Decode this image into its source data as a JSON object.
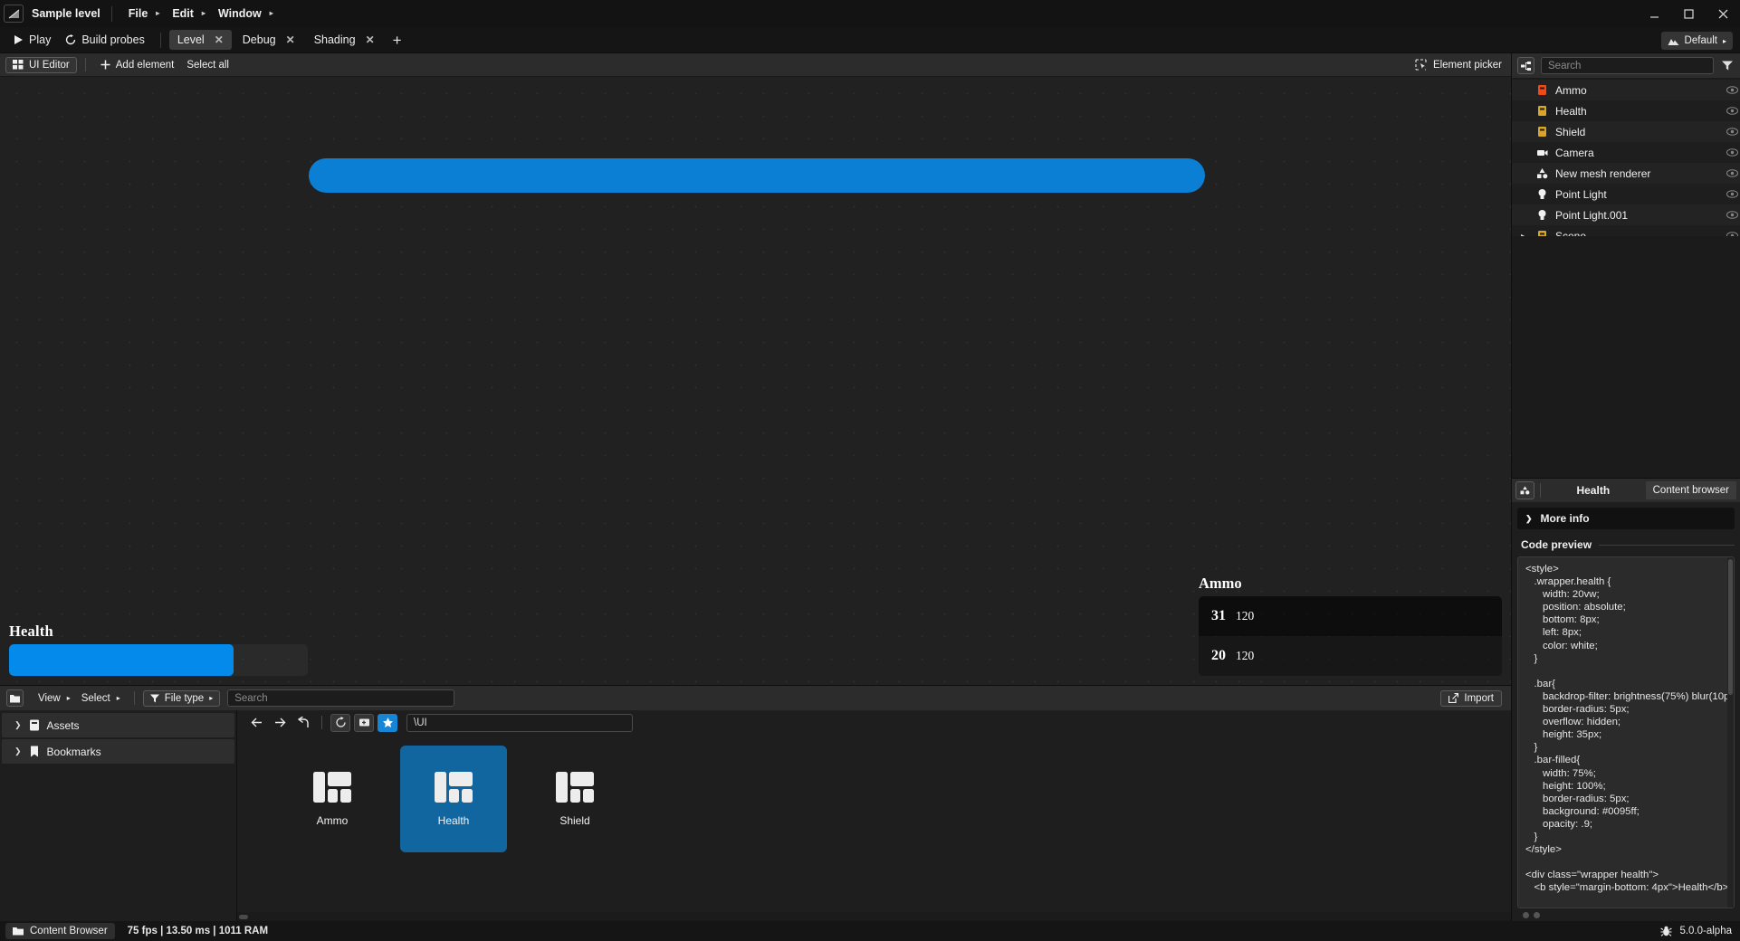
{
  "titlebar": {
    "logo_icon": "app-logo-icon",
    "project_title": "Sample level",
    "menus": [
      {
        "label": "File",
        "caret": "▸"
      },
      {
        "label": "Edit",
        "caret": "▸"
      },
      {
        "label": "Window",
        "caret": "▸"
      }
    ],
    "window_controls": [
      "minimize-icon",
      "maximize-icon",
      "close-icon"
    ]
  },
  "tabstrip": {
    "play_label": "Play",
    "build_probes_label": "Build probes",
    "tabs": [
      {
        "label": "Level",
        "active": true,
        "close": "✕"
      },
      {
        "label": "Debug",
        "active": false,
        "close": "✕"
      },
      {
        "label": "Shading",
        "active": false,
        "close": "✕"
      }
    ],
    "add_tab": "+",
    "layout": {
      "icon": "mountain-icon",
      "label": "Default",
      "caret": "▸"
    }
  },
  "editor_toolbar": {
    "mode_chip": "UI Editor",
    "add_element_label": "Add element",
    "select_all_label": "Select all",
    "element_picker_label": "Element picker"
  },
  "viewport": {
    "top_bar_color": "#0b7fd4",
    "health_widget": {
      "title": "Health",
      "fill_percent": 75,
      "fill_color": "#0095ff"
    },
    "ammo_widget": {
      "title": "Ammo",
      "rows": [
        {
          "current": "31",
          "max": "120"
        },
        {
          "current": "20",
          "max": "120"
        }
      ]
    }
  },
  "content_browser": {
    "folder_icon": "folder-icon",
    "view_label": "View",
    "select_label": "Select",
    "file_type_label": "File type",
    "search_placeholder": "Search",
    "search_value": "",
    "import_label": "Import",
    "tree": [
      {
        "label": "Assets",
        "icon": "assets-icon",
        "caret": "❯"
      },
      {
        "label": "Bookmarks",
        "icon": "bookmark-icon",
        "caret": "❯"
      }
    ],
    "nav": {
      "back": "arrow-left-icon",
      "forward": "arrow-right-icon",
      "up": "arrow-up-level-icon",
      "refresh": "refresh-icon",
      "new_folder": "new-item-icon",
      "favorite": "star-icon",
      "path_value": "\\UI"
    },
    "tiles": [
      {
        "label": "Ammo",
        "icon": "ui-layout-icon",
        "selected": false
      },
      {
        "label": "Health",
        "icon": "ui-layout-icon",
        "selected": true
      },
      {
        "label": "Shield",
        "icon": "ui-layout-icon",
        "selected": false
      }
    ]
  },
  "hierarchy": {
    "tree_icon": "hierarchy-icon",
    "search_placeholder": "Search",
    "search_value": "",
    "filter_icon": "funnel-icon",
    "nodes": [
      {
        "label": "Ammo",
        "icon": "ui-widget-icon",
        "icon_color": "#f04a16",
        "expandable": false
      },
      {
        "label": "Health",
        "icon": "ui-widget-icon",
        "icon_color": "#d9a528",
        "expandable": false
      },
      {
        "label": "Shield",
        "icon": "ui-widget-icon",
        "icon_color": "#d9a528",
        "expandable": false
      },
      {
        "label": "Camera",
        "icon": "camera-icon",
        "icon_color": "#ffffff",
        "expandable": false
      },
      {
        "label": "New mesh renderer",
        "icon": "mesh-icon",
        "icon_color": "#ffffff",
        "expandable": false
      },
      {
        "label": "Point Light",
        "icon": "light-icon",
        "icon_color": "#ffffff",
        "expandable": false
      },
      {
        "label": "Point Light.001",
        "icon": "light-icon",
        "icon_color": "#ffffff",
        "expandable": false
      },
      {
        "label": "Scene",
        "icon": "ui-widget-icon",
        "icon_color": "#d9a528",
        "expandable": true,
        "caret": "▸"
      }
    ]
  },
  "inspector": {
    "node_icon": "shapes-icon",
    "title": "Health",
    "content_browser_tab": "Content browser",
    "more_info_label": "More info",
    "more_info_caret": "❯",
    "code_preview_label": "Code preview",
    "code": "<style>\n   .wrapper.health {\n      width: 20vw;\n      position: absolute;\n      bottom: 8px;\n      left: 8px;\n      color: white;\n   }\n\n   .bar{\n      backdrop-filter: brightness(75%) blur(10p\n      border-radius: 5px;\n      overflow: hidden;\n      height: 35px;\n   }\n   .bar-filled{\n      width: 75%;\n      height: 100%;\n      border-radius: 5px;\n      background: #0095ff;\n      opacity: .9;\n   }\n</style>\n\n<div class=\"wrapper health\">\n   <b style=\"margin-bottom: 4px\">Health</b>"
  },
  "statusbar": {
    "content_browser_label": "Content Browser",
    "stats": "75 fps | 13.50 ms | 1011 RAM",
    "bug_icon": "bug-icon",
    "version": "5.0.0-alpha"
  }
}
